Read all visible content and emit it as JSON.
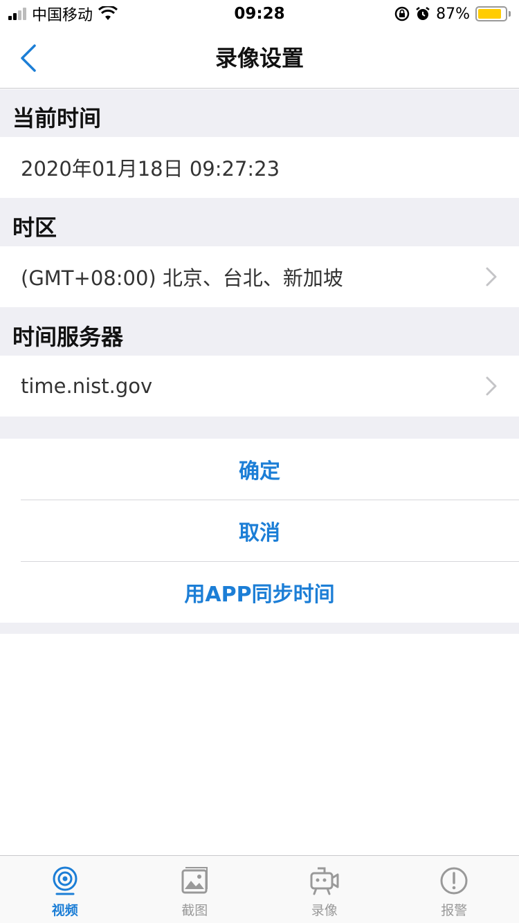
{
  "status_bar": {
    "carrier": "中国移动",
    "time": "09:28",
    "battery_percent": "87%",
    "battery_level": 0.87,
    "battery_color": "#ffcc00"
  },
  "nav": {
    "title": "录像设置"
  },
  "sections": {
    "current_time": {
      "header": "当前时间",
      "value": "2020年01月18日 09:27:23"
    },
    "timezone": {
      "header": "时区",
      "value": "(GMT+08:00) 北京、台北、新加坡"
    },
    "time_server": {
      "header": "时间服务器",
      "value": "time.nist.gov"
    }
  },
  "actions": {
    "confirm": "确定",
    "cancel": "取消",
    "sync": "用APP同步时间"
  },
  "tabs": [
    {
      "label": "视频",
      "icon": "camera-icon",
      "active": true
    },
    {
      "label": "截图",
      "icon": "image-icon",
      "active": false
    },
    {
      "label": "录像",
      "icon": "video-icon",
      "active": false
    },
    {
      "label": "报警",
      "icon": "alert-icon",
      "active": false
    }
  ],
  "colors": {
    "accent": "#1c7ed6",
    "section_bg": "#efeff4",
    "inactive_tab": "#999999"
  }
}
